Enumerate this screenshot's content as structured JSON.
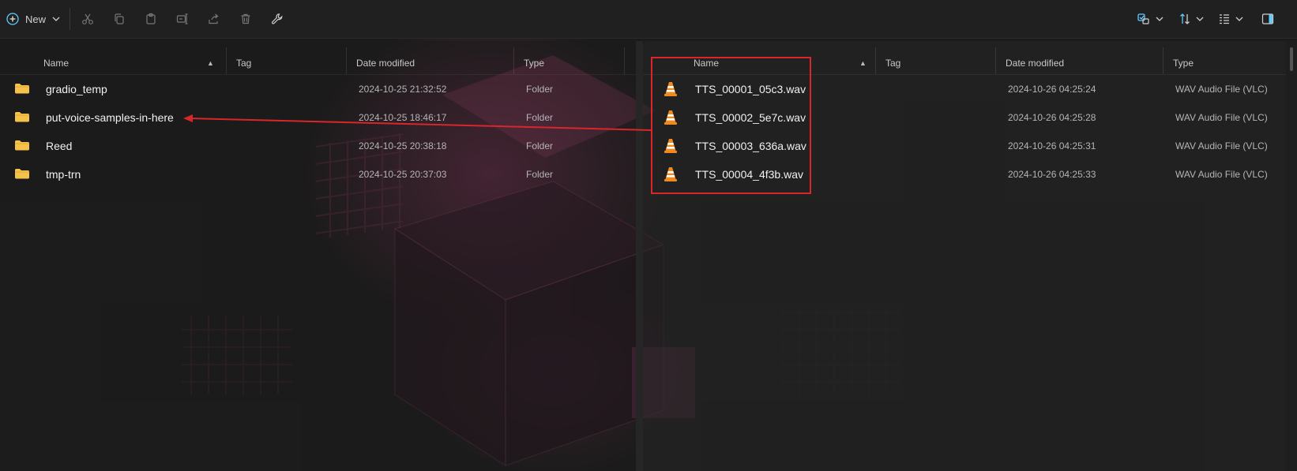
{
  "toolbar": {
    "new_label": "New",
    "actions": [
      "cut",
      "copy",
      "paste",
      "rename",
      "share",
      "delete",
      "properties"
    ]
  },
  "left_pane": {
    "columns": {
      "name": "Name",
      "tag": "Tag",
      "date": "Date modified",
      "type": "Type"
    },
    "rows": [
      {
        "name": "gradio_temp",
        "date": "2024-10-25 21:32:52",
        "type": "Folder"
      },
      {
        "name": "put-voice-samples-in-here",
        "date": "2024-10-25 18:46:17",
        "type": "Folder"
      },
      {
        "name": "Reed",
        "date": "2024-10-25 20:38:18",
        "type": "Folder"
      },
      {
        "name": "tmp-trn",
        "date": "2024-10-25 20:37:03",
        "type": "Folder"
      }
    ]
  },
  "right_pane": {
    "columns": {
      "name": "Name",
      "tag": "Tag",
      "date": "Date modified",
      "type": "Type"
    },
    "rows": [
      {
        "name": "TTS_00001_05c3.wav",
        "date": "2024-10-26 04:25:24",
        "type": "WAV Audio File (VLC)"
      },
      {
        "name": "TTS_00002_5e7c.wav",
        "date": "2024-10-26 04:25:28",
        "type": "WAV Audio File (VLC)"
      },
      {
        "name": "TTS_00003_636a.wav",
        "date": "2024-10-26 04:25:31",
        "type": "WAV Audio File (VLC)"
      },
      {
        "name": "TTS_00004_4f3b.wav",
        "date": "2024-10-26 04:25:33",
        "type": "WAV Audio File (VLC)"
      }
    ]
  },
  "colors": {
    "accent": "#60cdff",
    "annotation": "#d8262a",
    "folder": "#f4c24b",
    "vlc": "#f08a1d"
  }
}
